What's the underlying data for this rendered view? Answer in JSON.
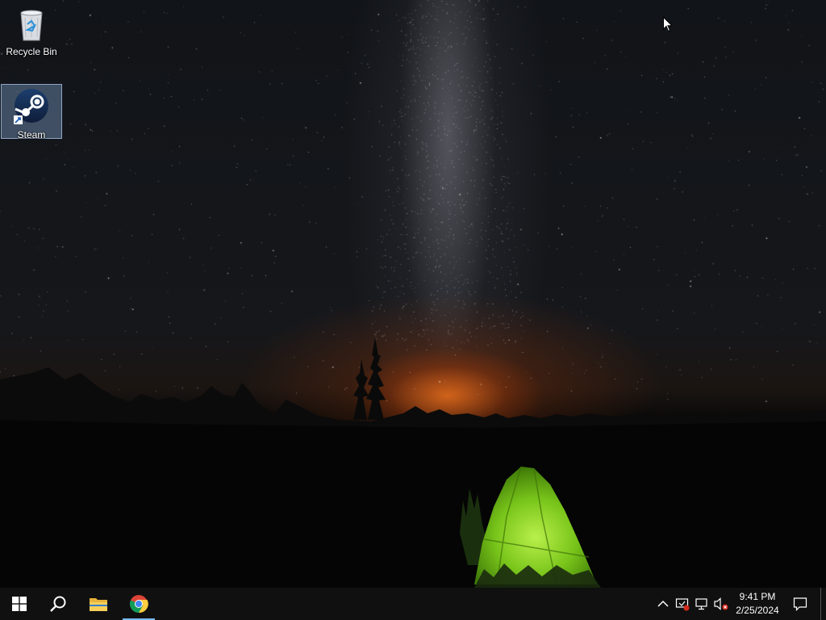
{
  "desktop": {
    "wallpaper": "night sky milky way over mountains with green tent",
    "icons": [
      {
        "name": "recycle-bin",
        "label": "Recycle Bin",
        "icon": "recycle-bin-icon",
        "selected": false
      },
      {
        "name": "steam",
        "label": "Steam",
        "icon": "steam-icon",
        "selected": true,
        "shortcut": true
      }
    ]
  },
  "taskbar": {
    "start": {
      "icon": "windows-logo-icon"
    },
    "search": {
      "icon": "search-icon"
    },
    "pinned": [
      {
        "name": "file-explorer",
        "icon": "folder-icon",
        "active": false
      },
      {
        "name": "google-chrome",
        "icon": "chrome-icon",
        "active": true
      }
    ],
    "tray": {
      "icons": [
        "chevron-up-icon",
        "security-alert-icon",
        "network-disconnected-icon",
        "volume-muted-icon"
      ],
      "time": "9:41 PM",
      "date": "2/25/2024"
    },
    "notifications": {
      "icon": "action-center-icon"
    }
  },
  "colors": {
    "taskbar_bg": "#101010",
    "active_indicator": "#76b9ed",
    "tent_green": "#7ed321",
    "selection": "#7896be"
  }
}
